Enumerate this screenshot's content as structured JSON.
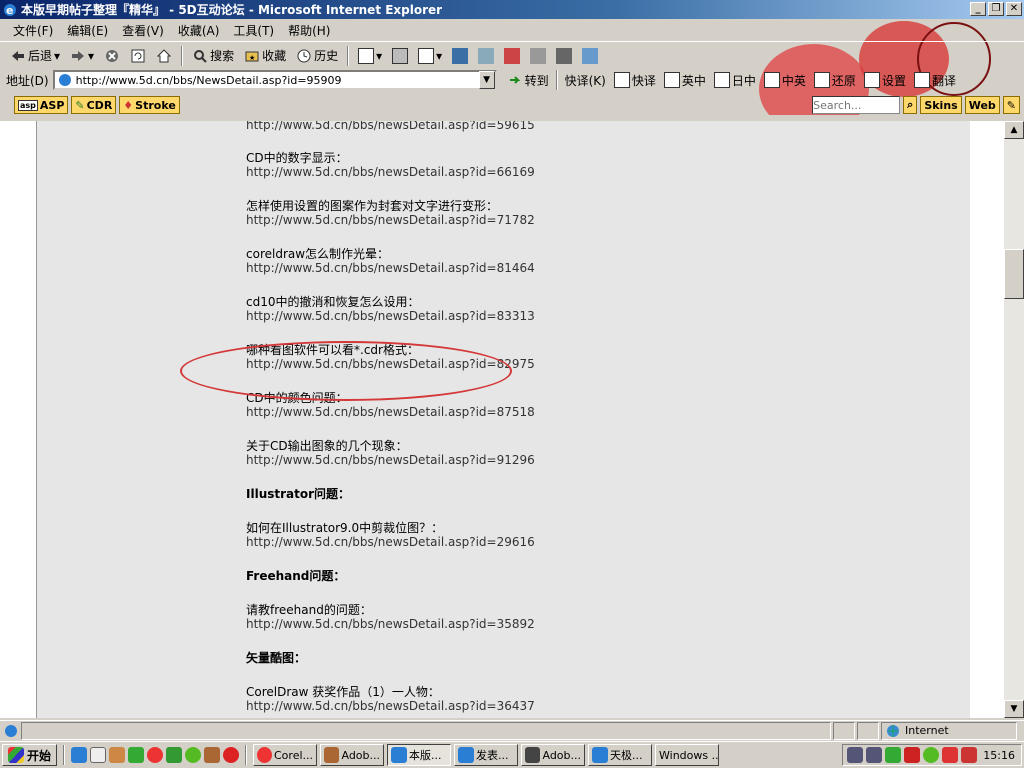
{
  "window": {
    "title": "本版早期帖子整理『精华』 - 5D互动论坛 - Microsoft Internet Explorer"
  },
  "menu": [
    "文件(F)",
    "编辑(E)",
    "查看(V)",
    "收藏(A)",
    "工具(T)",
    "帮助(H)"
  ],
  "toolbar": {
    "back": "后退",
    "search": "搜索",
    "favorites": "收藏",
    "history": "历史"
  },
  "address": {
    "label": "地址(D)",
    "url": "http://www.5d.cn/bbs/NewsDetail.asp?id=95909",
    "go": "转到",
    "translate_items": [
      "快译(K)",
      "快译",
      "英中",
      "日中",
      "中英",
      "还原",
      "设置",
      "翻译"
    ]
  },
  "links": {
    "asp": "ASP",
    "cdr": "CDR",
    "stroke": "Stroke",
    "search_placeholder": "Search...",
    "skins": "Skins",
    "web": "Web"
  },
  "content": {
    "top_partial_link": "http://www.5d.cn/bbs/newsDetail.asp?id=59615",
    "entries": [
      {
        "title": "CD中的数字显示：",
        "link": "http://www.5d.cn/bbs/newsDetail.asp?id=66169"
      },
      {
        "title": "怎样使用设置的图案作为封套对文字进行变形：",
        "link": "http://www.5d.cn/bbs/newsDetail.asp?id=71782"
      },
      {
        "title": "coreldraw怎么制作光晕：",
        "link": "http://www.5d.cn/bbs/newsDetail.asp?id=81464"
      },
      {
        "title": "cd10中的撤消和恢复怎么设用：",
        "link": "http://www.5d.cn/bbs/newsDetail.asp?id=83313"
      },
      {
        "title": "哪种看图软件可以看*.cdr格式：",
        "link": "http://www.5d.cn/bbs/newsDetail.asp?id=82975"
      },
      {
        "title": "CD中的颜色问题：",
        "link": "http://www.5d.cn/bbs/newsDetail.asp?id=87518"
      },
      {
        "title": "关于CD输出图象的几个现象：",
        "link": "http://www.5d.cn/bbs/newsDetail.asp?id=91296"
      }
    ],
    "section_illustrator": "Illustrator问题：",
    "illustrator_entry": {
      "title": "如何在Illustrator9.0中剪裁位图？：",
      "link": "http://www.5d.cn/bbs/newsDetail.asp?id=29616"
    },
    "section_freehand": "Freehand问题：",
    "freehand_entry": {
      "title": "请教freehand的问题：",
      "link": "http://www.5d.cn/bbs/newsDetail.asp?id=35892"
    },
    "section_vector": "矢量酷图：",
    "vector_entry": {
      "title": "CorelDraw 获奖作品（1）一人物：",
      "link": "http://www.5d.cn/bbs/newsDetail.asp?id=36437"
    }
  },
  "status": {
    "zone": "Internet"
  },
  "taskbar": {
    "start": "开始",
    "tasks": [
      "Corel...",
      "Adob...",
      "本版...",
      "发表...",
      "Adob...",
      "天极...",
      "Windows ..."
    ],
    "clock": "15:16"
  }
}
